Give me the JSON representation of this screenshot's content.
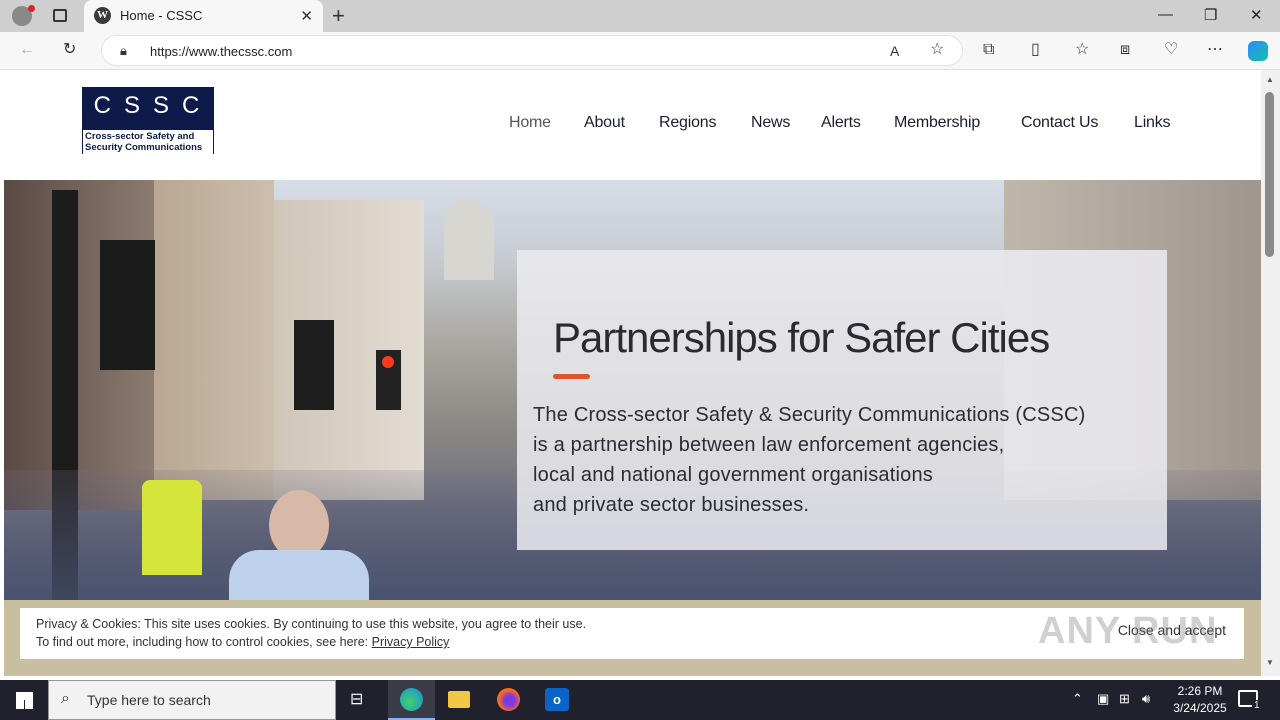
{
  "browser": {
    "tab_title": "Home - CSSC",
    "url": "https://www.thecssc.com",
    "window_controls": [
      "minimize",
      "restore",
      "close"
    ]
  },
  "site": {
    "logo_letters": "CSSC",
    "logo_subtitle": "Cross-sector Safety and Security Communications",
    "nav": [
      "Home",
      "About",
      "Regions",
      "News",
      "Alerts",
      "Membership",
      "Contact Us",
      "Links"
    ],
    "active_nav": "Home"
  },
  "hero": {
    "title": "Partnerships for Safer Cities",
    "lines": [
      "The Cross-sector Safety & Security Communications (CSSC)",
      "is a partnership between law enforcement agencies,",
      "local and national government organisations",
      "and private sector businesses."
    ]
  },
  "cookie": {
    "line1": "Privacy & Cookies: This site uses cookies. By continuing to use this website, you agree to their use.",
    "line2_prefix": "To find out more, including how to control cookies, see here:",
    "link": "Privacy Policy",
    "button": "Close and accept"
  },
  "taskbar": {
    "search_placeholder": "Type here to search",
    "time": "2:26 PM",
    "date": "3/24/2025",
    "notification_count": "1"
  },
  "watermark": "ANY RUN",
  "colors": {
    "logo_navy": "#0d1a4a",
    "accent_rule": "#e0542a",
    "taskbar": "#20212c"
  }
}
